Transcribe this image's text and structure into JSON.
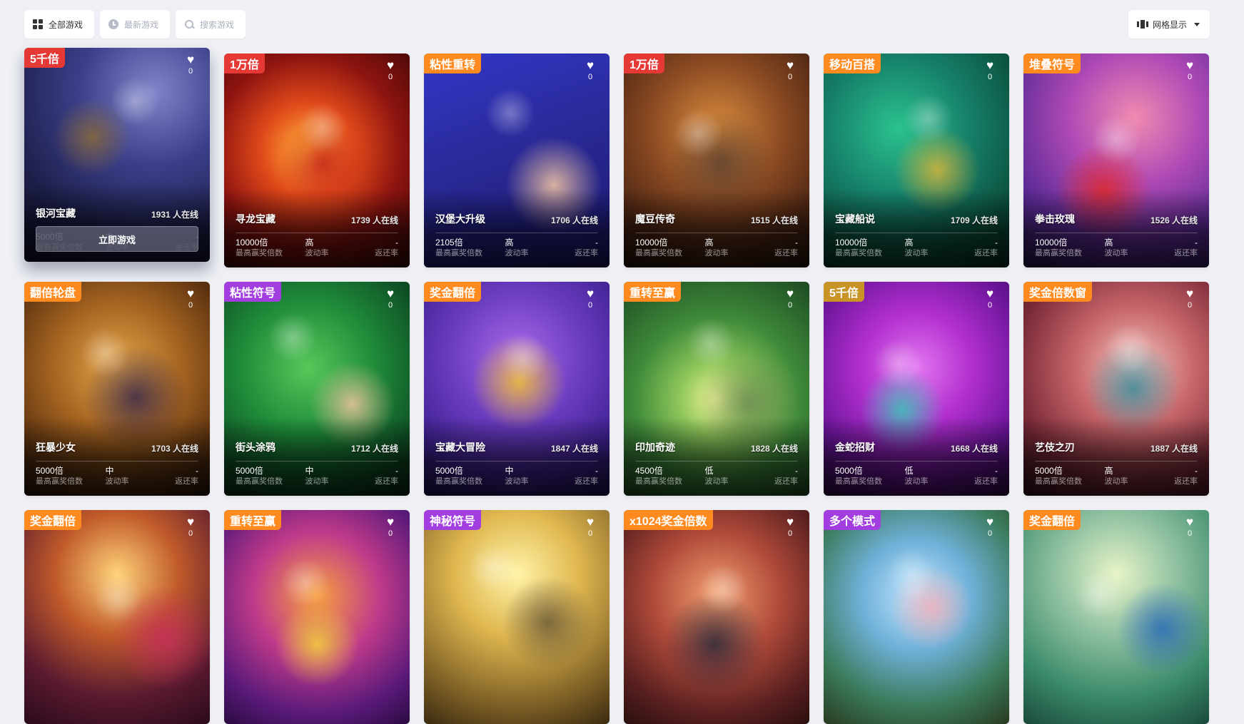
{
  "toolbar": {
    "all_games": "全部游戏",
    "latest_games": "最新游戏",
    "search_games": "搜索游戏",
    "view_mode": "网格显示"
  },
  "labels": {
    "max_win": "最高赢奖倍数",
    "volatility": "波动率",
    "rtp": "返还率",
    "play_now": "立即游戏"
  },
  "games": [
    {
      "tag": "5千倍",
      "tag_color": "#e53935",
      "name": "银河宝藏",
      "online": "1931 人在线",
      "max_win": "5000倍",
      "volatility": "中",
      "rtp": "-",
      "fav": "0",
      "hover": true,
      "bg": "radial-gradient(circle at 70% 20%, #7f84c9 0%, #3b3f8a 35%, #1d1f4a 70%, #0f1030 100%)",
      "orb": "#8a6a3a"
    },
    {
      "tag": "1万倍",
      "tag_color": "#e53935",
      "name": "寻龙宝藏",
      "online": "1739 人在线",
      "max_win": "10000倍",
      "volatility": "高",
      "rtp": "-",
      "fav": "0",
      "hover": false,
      "bg": "radial-gradient(circle at 45% 45%, #ffb33b 0%, #e0491a 30%, #8e1410 60%, #3a0606 100%)",
      "orb": "#c6261b"
    },
    {
      "tag": "粘性重转",
      "tag_color": "#ff8a1f",
      "name": "汉堡大升级",
      "online": "1706 人在线",
      "max_win": "2105倍",
      "volatility": "高",
      "rtp": "-",
      "fav": "0",
      "hover": false,
      "bg": "linear-gradient(160deg, #3236c8 0%, #2a2a98 45%, #1b176e 100%)",
      "orb": "#f6c8a6"
    },
    {
      "tag": "1万倍",
      "tag_color": "#e53935",
      "name": "魔豆传奇",
      "online": "1515 人在线",
      "max_win": "10000倍",
      "volatility": "高",
      "rtp": "-",
      "fav": "0",
      "hover": false,
      "bg": "radial-gradient(circle at 50% 35%, #d98a3d 0%, #8b4a22 40%, #4a2413 75%, #2a140a 100%)",
      "orb": "#5f4330"
    },
    {
      "tag": "移动百搭",
      "tag_color": "#ff8a1f",
      "name": "宝藏船说",
      "online": "1709 人在线",
      "max_win": "10000倍",
      "volatility": "高",
      "rtp": "-",
      "fav": "0",
      "hover": false,
      "bg": "radial-gradient(circle at 40% 35%, #2bc28f 0%, #16806a 40%, #0b4f3c 75%, #07302a 100%)",
      "orb": "#d8b63a"
    },
    {
      "tag": "堆叠符号",
      "tag_color": "#ff8a1f",
      "name": "拳击玫瑰",
      "online": "1526 人在线",
      "max_win": "10000倍",
      "volatility": "高",
      "rtp": "-",
      "fav": "0",
      "hover": false,
      "bg": "radial-gradient(circle at 60% 30%, #f08bb0 0%, #b04ab6 35%, #5b2a96 70%, #2c1856 100%)",
      "orb": "#e02828"
    },
    {
      "tag": "翻倍轮盘",
      "tag_color": "#ff8a1f",
      "name": "狂暴少女",
      "online": "1703 人在线",
      "max_win": "5000倍",
      "volatility": "中",
      "rtp": "-",
      "fav": "0",
      "hover": false,
      "bg": "radial-gradient(circle at 50% 40%, #e5a64a 0%, #a76521 40%, #5c3210 75%, #2f1806 100%)",
      "orb": "#3a2a4a"
    },
    {
      "tag": "粘性符号",
      "tag_color": "#a23de0",
      "name": "街头涂鸦",
      "online": "1712 人在线",
      "max_win": "5000倍",
      "volatility": "中",
      "rtp": "-",
      "fav": "0",
      "hover": false,
      "bg": "radial-gradient(circle at 45% 40%, #57c85a 0%, #1f8d3a 40%, #0f5026 75%, #082a15 100%)",
      "orb": "#f2c4a0"
    },
    {
      "tag": "奖金翻倍",
      "tag_color": "#ff8a1f",
      "name": "宝藏大冒险",
      "online": "1847 人在线",
      "max_win": "5000倍",
      "volatility": "中",
      "rtp": "-",
      "fav": "0",
      "hover": false,
      "bg": "radial-gradient(circle at 50% 35%, #a96ae8 0%, #6a3cc0 40%, #3d2090 75%, #22125a 100%)",
      "orb": "#f2c230"
    },
    {
      "tag": "重转至赢",
      "tag_color": "#ff8a1f",
      "name": "印加奇迹",
      "online": "1828 人在线",
      "max_win": "4500倍",
      "volatility": "低",
      "rtp": "-",
      "fav": "0",
      "hover": false,
      "bg": "radial-gradient(circle at 50% 55%, #f3f59a 0%, #8ec65a 25%, #3e8a3a 55%, #1d4a22 100%)",
      "orb": "#6b8a52"
    },
    {
      "tag": "5千倍",
      "tag_color": "#c99426",
      "name": "金蛇招财",
      "online": "1668 人在线",
      "max_win": "5000倍",
      "volatility": "低",
      "rtp": "-",
      "fav": "0",
      "hover": false,
      "bg": "radial-gradient(circle at 50% 40%, #e276f0 0%, #b22fcf 35%, #6b159a 70%, #350a52 100%)",
      "orb": "#37c9b5"
    },
    {
      "tag": "奖金倍数窗",
      "tag_color": "#ff8a1f",
      "name": "艺伎之刃",
      "online": "1887 人在线",
      "max_win": "5000倍",
      "volatility": "高",
      "rtp": "-",
      "fav": "0",
      "hover": false,
      "bg": "radial-gradient(circle at 60% 40%, #f2c7c0 0%, #c8666a 35%, #7a2a38 70%, #3a121c 100%)",
      "orb": "#3a8a9a"
    },
    {
      "tag": "奖金翻倍",
      "tag_color": "#ff8a1f",
      "name": "",
      "online": "",
      "max_win": "",
      "volatility": "",
      "rtp": "",
      "fav": "0",
      "hover": false,
      "bg": "radial-gradient(circle at 50% 30%, #ffd37a 0%, #c05a2a 35%, #5a1a30 70%, #2a0a1a 100%)",
      "orb": "#c8305a"
    },
    {
      "tag": "重转至赢",
      "tag_color": "#ff8a1f",
      "name": "",
      "online": "",
      "max_win": "",
      "volatility": "",
      "rtp": "",
      "fav": "0",
      "hover": false,
      "bg": "radial-gradient(circle at 50% 40%, #f7a040 0%, #c03a8a 40%, #5a1a7a 75%, #2a0a40 100%)",
      "orb": "#f2d23a"
    },
    {
      "tag": "神秘符号",
      "tag_color": "#a23de0",
      "name": "",
      "online": "",
      "max_win": "",
      "volatility": "",
      "rtp": "",
      "fav": "0",
      "hover": false,
      "bg": "radial-gradient(circle at 50% 30%, #fff3a8 0%, #e0b850 35%, #8a6a2a 70%, #3a2a10 100%)",
      "orb": "#6a5a3a"
    },
    {
      "tag": "x1024奖金倍数",
      "tag_color": "#ff8a1f",
      "name": "",
      "online": "",
      "max_win": "",
      "volatility": "",
      "rtp": "",
      "fav": "0",
      "hover": false,
      "bg": "radial-gradient(circle at 50% 40%, #f2a070 0%, #b04a3a 40%, #5a2020 75%, #2a0e0e 100%)",
      "orb": "#2a2a3a"
    },
    {
      "tag": "多个模式",
      "tag_color": "#a23de0",
      "name": "",
      "online": "",
      "max_win": "",
      "volatility": "",
      "rtp": "",
      "fav": "0",
      "hover": false,
      "bg": "radial-gradient(circle at 50% 40%, #bfe6ff 0%, #6fb0d8 35%, #3a7a5a 70%, #2a3a20 100%)",
      "orb": "#f2b0b8"
    },
    {
      "tag": "奖金翻倍",
      "tag_color": "#ff8a1f",
      "name": "",
      "online": "",
      "max_win": "",
      "volatility": "",
      "rtp": "",
      "fav": "0",
      "hover": false,
      "bg": "radial-gradient(circle at 50% 30%, #e8f4c8 0%, #8ec0a0 35%, #3a8a6a 70%, #1a4a3a 100%)",
      "orb": "#2a6ab8"
    }
  ]
}
